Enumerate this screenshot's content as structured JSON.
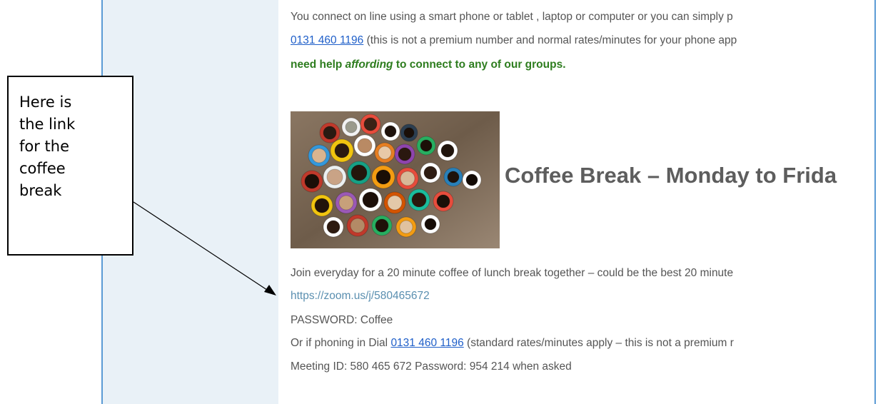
{
  "email": {
    "intro_line1": "You connect on line using a smart phone or tablet , laptop or computer or you can simply p",
    "intro_phone": "0131 460 1196",
    "intro_line2_rest": " (this is not a premium number and normal rates/minutes for your phone app",
    "intro_line3": "need help ",
    "intro_line3_italic": "affording",
    "intro_line3_rest": " to connect to any of our groups.",
    "heading": "Coffee Break – Monday to Frida",
    "join_text": "Join everyday for a 20 minute coffee of lunch break together – could be the best 20 minute",
    "zoom_link": "https://zoom.us/j/580465672",
    "password_line": "PASSWORD: Coffee",
    "dial_prefix": "Or if phoning in Dial ",
    "dial_phone": "0131 460 1196",
    "dial_rest": " (standard rates/minutes apply – this is not a premium r",
    "meeting_line": "Meeting ID: 580 465 672 Password: 954 214 when asked"
  },
  "callout": {
    "lines": [
      "Here is",
      "the link",
      "for the",
      "coffee",
      "break"
    ]
  },
  "colors": {
    "frame_border": "#5b9bd5",
    "sidebar_bg": "#e9f1f7",
    "link_blue": "#1f5fc9",
    "green_text": "#2e7d1f",
    "zoom_link": "#5a8fb0"
  }
}
